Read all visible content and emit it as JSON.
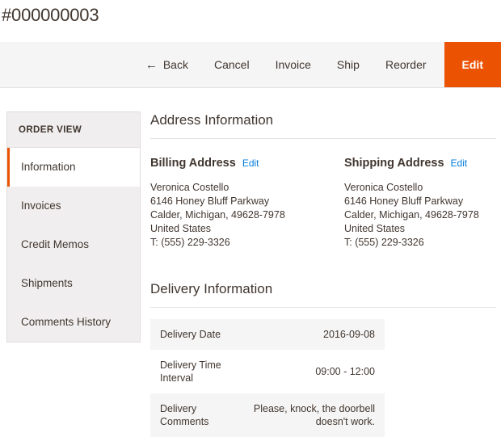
{
  "page": {
    "order_id": "#000000003"
  },
  "toolbar": {
    "back_icon": "arrow-left-icon",
    "back_arrow_glyph": "←",
    "buttons": [
      {
        "label": "Back",
        "style": "link"
      },
      {
        "label": "Cancel",
        "style": "link"
      },
      {
        "label": "Invoice",
        "style": "link"
      },
      {
        "label": "Ship",
        "style": "link"
      },
      {
        "label": "Reorder",
        "style": "link"
      },
      {
        "label": "Edit",
        "style": "primary"
      }
    ]
  },
  "sidebar": {
    "title": "ORDER VIEW",
    "items": [
      {
        "label": "Information",
        "active": true
      },
      {
        "label": "Invoices",
        "active": false
      },
      {
        "label": "Credit Memos",
        "active": false
      },
      {
        "label": "Shipments",
        "active": false
      },
      {
        "label": "Comments History",
        "active": false
      }
    ]
  },
  "address_section": {
    "heading": "Address Information",
    "billing": {
      "title": "Billing Address",
      "edit_label": "Edit",
      "lines": [
        "Veronica Costello",
        "6146 Honey Bluff Parkway",
        "Calder, Michigan, 49628-7978",
        "United States",
        "T: (555) 229-3326"
      ]
    },
    "shipping": {
      "title": "Shipping Address",
      "edit_label": "Edit",
      "lines": [
        "Veronica Costello",
        "6146 Honey Bluff Parkway",
        "Calder, Michigan, 49628-7978",
        "United States",
        "T: (555) 229-3326"
      ]
    }
  },
  "delivery_section": {
    "heading": "Delivery Information",
    "rows": [
      {
        "label": "Delivery Date",
        "value": "2016-09-08"
      },
      {
        "label": "Delivery Time Interval",
        "value": "09:00 - 12:00"
      },
      {
        "label": "Delivery Comments",
        "value": "Please, knock, the doorbell doesn't work."
      }
    ]
  },
  "colors": {
    "accent": "#eb5202",
    "link": "#007bdb",
    "text": "#41362f",
    "toolbar_bg": "#f5f5f5",
    "sidebar_bg": "#f0eeee",
    "row_alt_bg": "#f5f5f5"
  }
}
